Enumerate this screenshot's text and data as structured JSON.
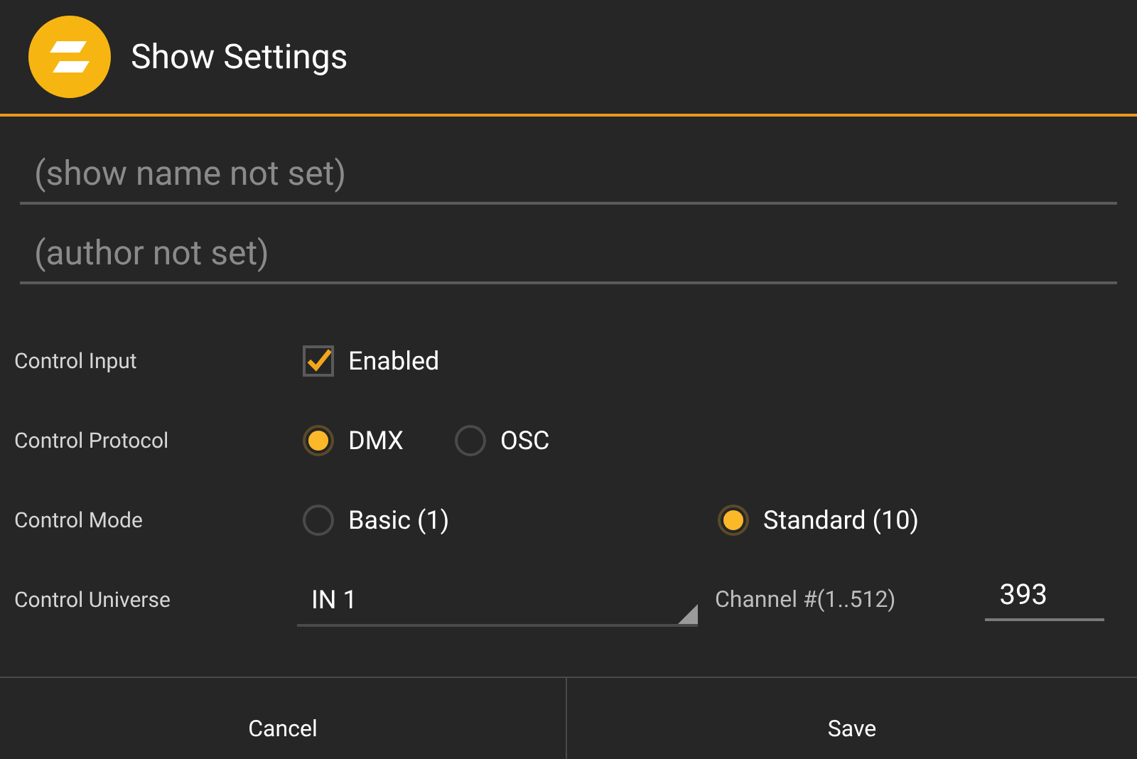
{
  "title": "Show Settings",
  "fields": [
    {
      "placeholder": "(show name not set)"
    },
    {
      "placeholder": "(author not set)"
    }
  ],
  "rows": [
    {
      "kind": "checkbox",
      "label": "Control Input",
      "option": "Enabled",
      "checked": true
    },
    {
      "kind": "radio",
      "label": "Control Protocol",
      "options": [
        {
          "label": "DMX",
          "selected": true
        },
        {
          "label": "OSC",
          "selected": false
        }
      ]
    },
    {
      "kind": "radio",
      "label": "Control Mode",
      "options": [
        {
          "label": "Basic (1)",
          "selected": false
        },
        {
          "label": "Standard (10)",
          "selected": true
        }
      ]
    },
    {
      "kind": "universe",
      "label": "Control Universe",
      "value": "IN 1",
      "channel_label": "Channel #(1..512)",
      "channel": "393"
    }
  ],
  "buttons": [
    "Cancel",
    "Save"
  ]
}
